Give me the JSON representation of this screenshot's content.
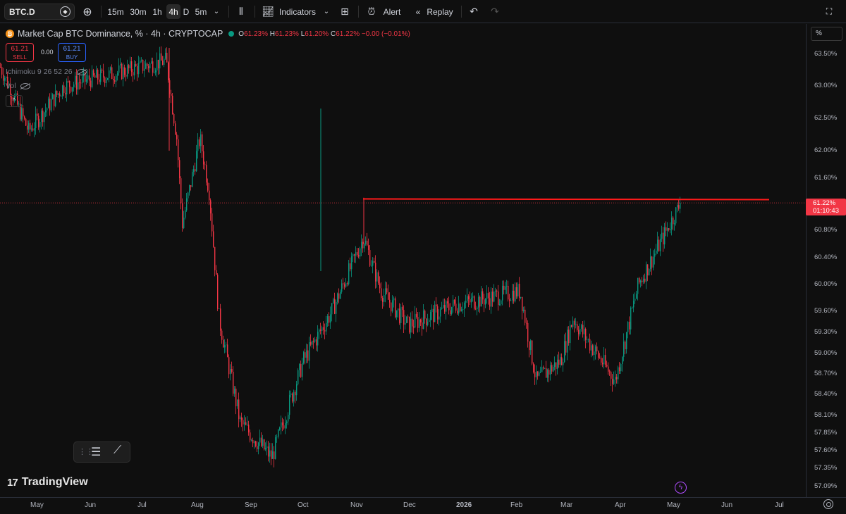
{
  "toolbar": {
    "symbol": "BTC.D",
    "intervals": [
      "15m",
      "30m",
      "1h",
      "4h",
      "D",
      "5m"
    ],
    "active_interval": "4h",
    "indicators_label": "Indicators",
    "alert_label": "Alert",
    "replay_label": "Replay"
  },
  "legend": {
    "title": "Market Cap BTC Dominance, % · 4h · CRYPTOCAP",
    "coin_glyph": "₿",
    "o_key": "O",
    "o_val": "61.23%",
    "h_key": "H",
    "h_val": "61.23%",
    "l_key": "L",
    "l_val": "61.20%",
    "c_key": "C",
    "c_val": "61.22%",
    "change": "−0.00 (−0.01%)",
    "sell_price": "61.21",
    "sell_label": "SELL",
    "buy_price": "61.21",
    "buy_label": "BUY",
    "spread": "0.00",
    "ichimoku": "Ichimoku 9 26 52 26",
    "vol": "Vol",
    "collapse": "^"
  },
  "price_axis": {
    "unit_button": "%",
    "ticks": [
      "63.50%",
      "63.00%",
      "62.50%",
      "62.00%",
      "61.60%",
      "60.80%",
      "60.40%",
      "60.00%",
      "59.60%",
      "59.30%",
      "59.00%",
      "58.70%",
      "58.40%",
      "58.10%",
      "57.85%",
      "57.60%",
      "57.35%",
      "57.09%"
    ],
    "last_price": "61.22%",
    "countdown": "01:10:43"
  },
  "time_axis": {
    "ticks": [
      "May",
      "Jun",
      "Jul",
      "Aug",
      "Sep",
      "Oct",
      "Nov",
      "Dec",
      "2026",
      "Feb",
      "Mar",
      "Apr",
      "May",
      "Jun",
      "Jul"
    ]
  },
  "brand": {
    "name": "TradingView",
    "mark": "17"
  },
  "colors": {
    "up": "#089981",
    "down": "#f23645",
    "line": "#ff1a1a",
    "bg": "#0f0f0f"
  },
  "chart_data": {
    "type": "candlestick",
    "ylim": [
      57.09,
      63.6
    ],
    "resistance_level": 61.27,
    "last_price": 61.22,
    "anchors": [
      {
        "x": "May 2025",
        "y": 63.3
      },
      {
        "x": "mid May",
        "y": 62.3
      },
      {
        "x": "late May",
        "y": 63.0
      },
      {
        "x": "Jul",
        "y": 63.4
      },
      {
        "x": "mid Jul",
        "y": 62.2
      },
      {
        "x": "late Jul",
        "y": 60.9
      },
      {
        "x": "early Aug",
        "y": 62.2
      },
      {
        "x": "Aug",
        "y": 61.4
      },
      {
        "x": "mid Aug",
        "y": 59.5
      },
      {
        "x": "Sep",
        "y": 58.0
      },
      {
        "x": "mid Sep",
        "y": 57.5
      },
      {
        "x": "Oct",
        "y": 58.9
      },
      {
        "x": "mid Oct",
        "y": 59.6
      },
      {
        "x": "Nov",
        "y": 60.7
      },
      {
        "x": "mid Nov",
        "y": 59.9
      },
      {
        "x": "Dec",
        "y": 59.4
      },
      {
        "x": "2026",
        "y": 59.7
      },
      {
        "x": "Feb",
        "y": 59.9
      },
      {
        "x": "mid Feb",
        "y": 58.6
      },
      {
        "x": "Mar",
        "y": 58.9
      },
      {
        "x": "mid Mar",
        "y": 59.5
      },
      {
        "x": "Apr",
        "y": 58.6
      },
      {
        "x": "mid Apr",
        "y": 60.0
      },
      {
        "x": "late Apr",
        "y": 60.7
      },
      {
        "x": "May 2026",
        "y": 61.22
      }
    ]
  }
}
